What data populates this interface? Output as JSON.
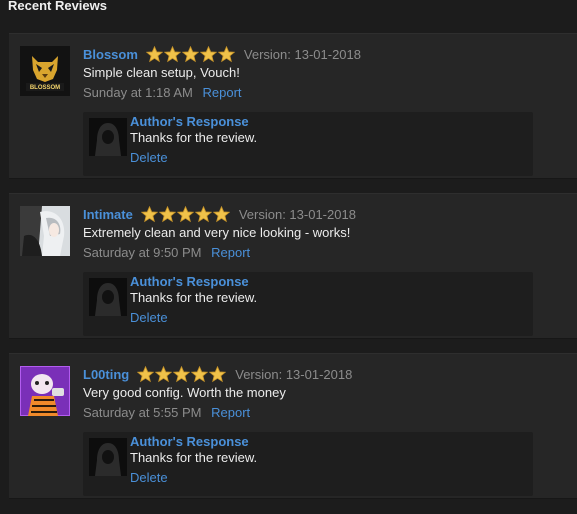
{
  "header": {
    "title": "Recent Reviews"
  },
  "colors": {
    "link": "#4a90d9",
    "star": "#f0c24a",
    "muted": "#8c8c8c",
    "panel": "#262626"
  },
  "reviews": [
    {
      "username": "Blossom",
      "avatar_text": "BLOSSOM",
      "rating": 5,
      "version": "Version: 13-01-2018",
      "message": "Simple clean setup, Vouch!",
      "time": "Sunday at 1:18 AM",
      "report_label": "Report",
      "response": {
        "title": "Author's Response",
        "text": "Thanks for the review.",
        "delete_label": "Delete"
      }
    },
    {
      "username": "Intimate",
      "rating": 5,
      "version": "Version: 13-01-2018",
      "message": "Extremely clean and very nice looking - works!",
      "time": "Saturday at 9:50 PM",
      "report_label": "Report",
      "response": {
        "title": "Author's Response",
        "text": "Thanks for the review.",
        "delete_label": "Delete"
      }
    },
    {
      "username": "L00ting",
      "rating": 5,
      "version": "Version: 13-01-2018",
      "message": "Very good config. Worth the money",
      "time": "Saturday at 5:55 PM",
      "report_label": "Report",
      "response": {
        "title": "Author's Response",
        "text": "Thanks for the review.",
        "delete_label": "Delete"
      }
    }
  ]
}
